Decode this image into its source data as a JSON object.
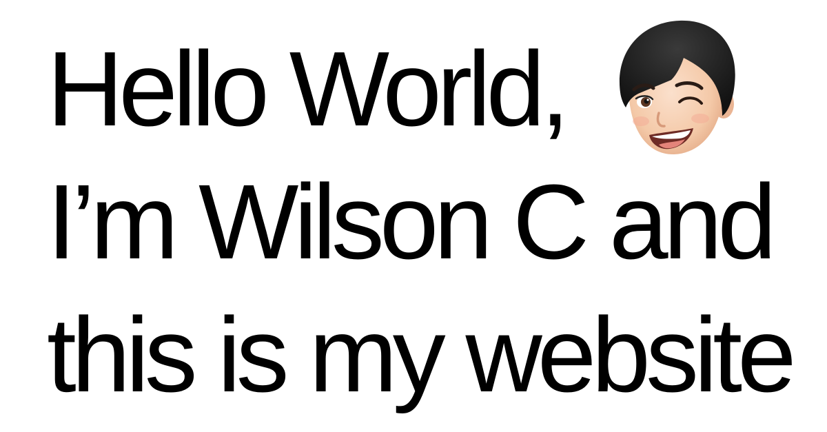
{
  "headline": {
    "line1": "Hello World,",
    "line2": "I’m Wilson C and",
    "line3": "this is my website"
  },
  "avatar": {
    "icon": "winking-memoji-avatar-icon"
  },
  "colors": {
    "background": "#ffffff",
    "text": "#000000",
    "hair": "#1c1c1c",
    "skin": "#f4c9a8"
  }
}
